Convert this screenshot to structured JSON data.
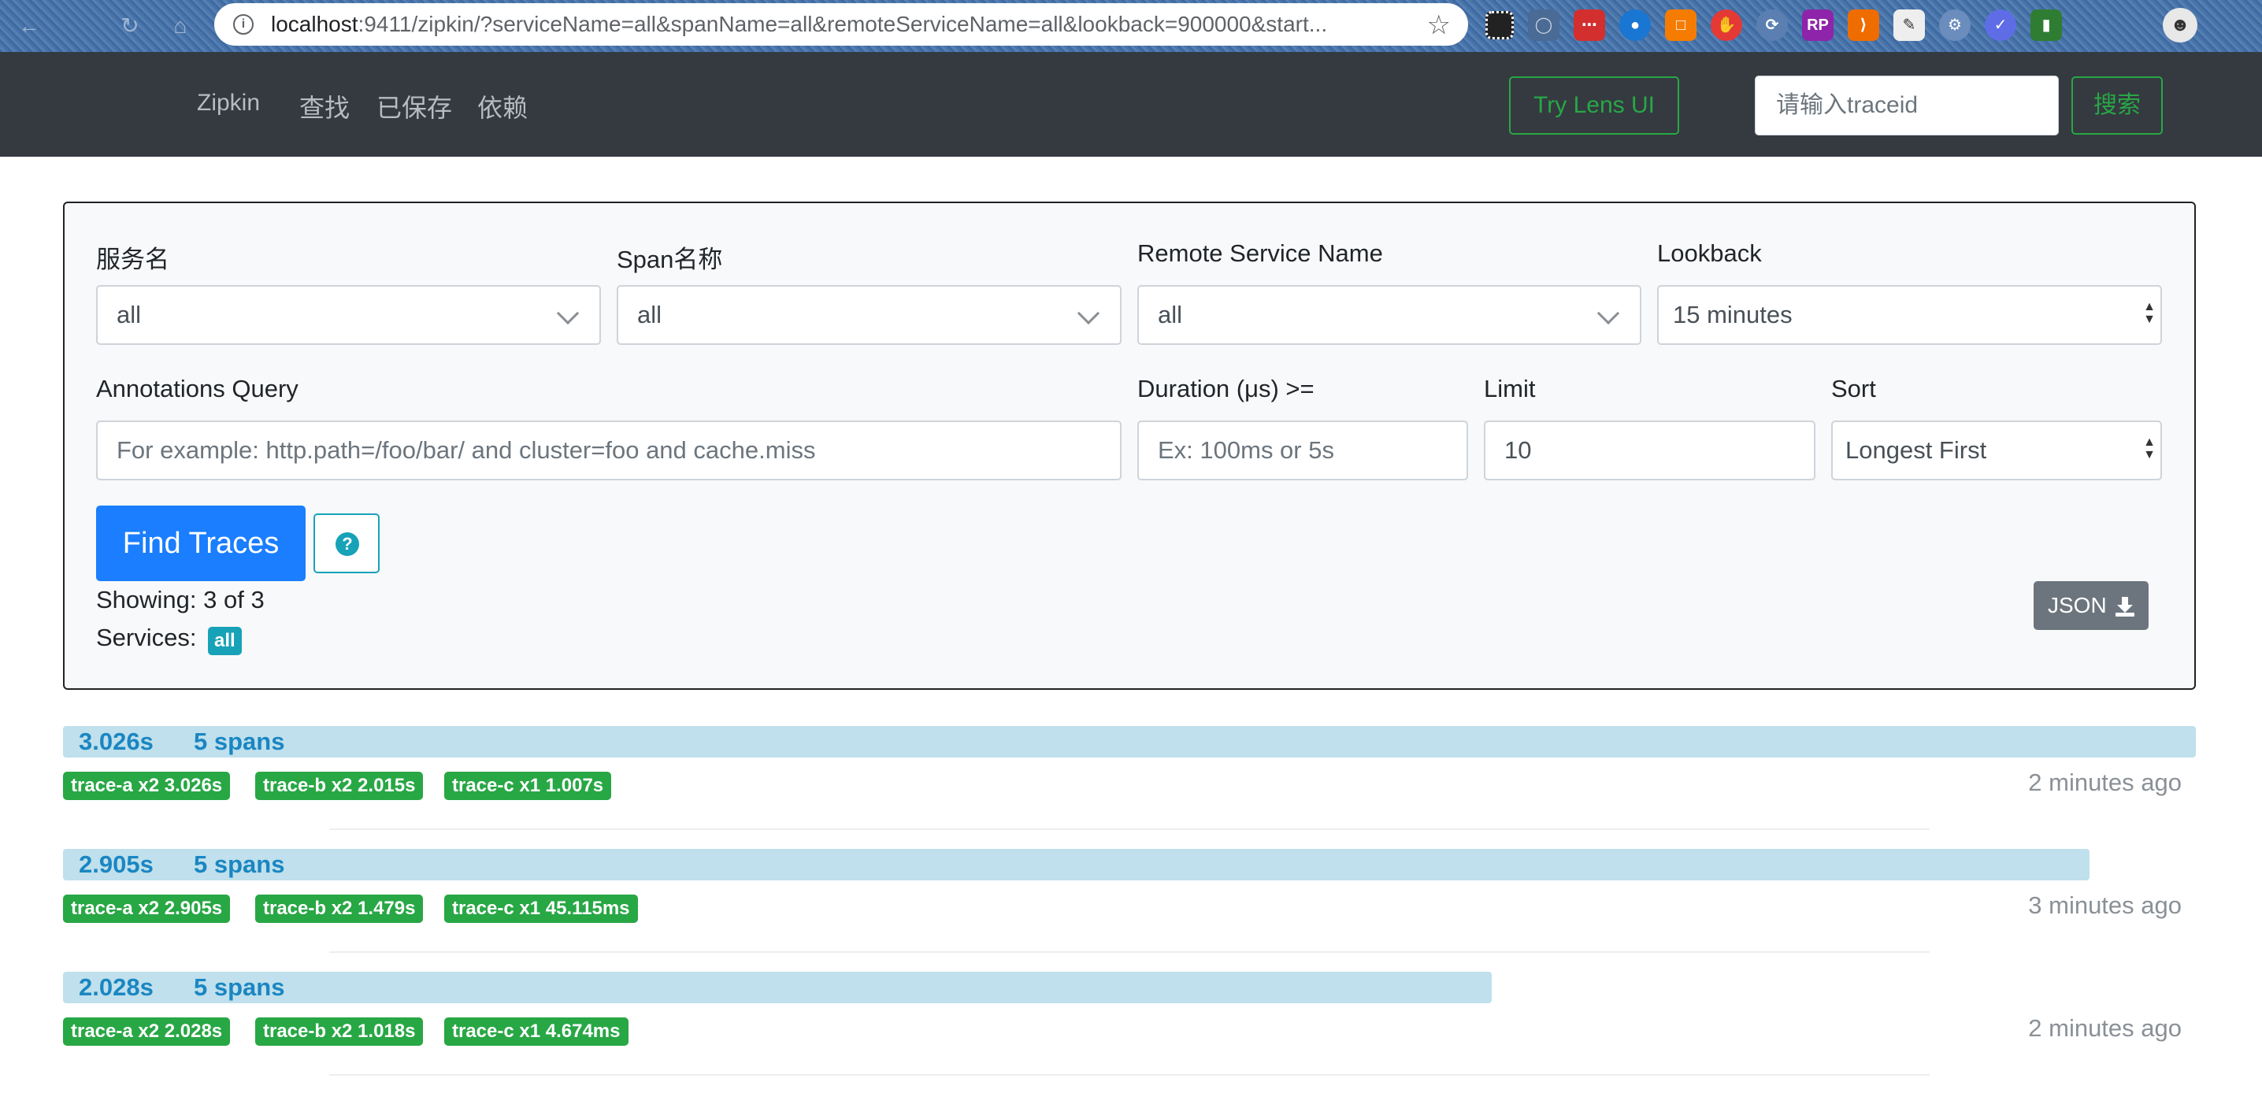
{
  "browser": {
    "url_host": "localhost",
    "url_rest": ":9411/zipkin/?serviceName=all&spanName=all&remoteServiceName=all&lookback=900000&start...",
    "icons": [
      "back-icon",
      "forward-icon",
      "home-icon",
      "info-icon",
      "star-icon"
    ]
  },
  "navbar": {
    "brand": "Zipkin",
    "links": [
      "查找",
      "已保存",
      "依赖"
    ],
    "lens_button": "Try Lens UI",
    "traceid_placeholder": "请输入traceid",
    "search_button": "搜索"
  },
  "search": {
    "service_label": "服务名",
    "service_value": "all",
    "span_label": "Span名称",
    "span_value": "all",
    "remote_label": "Remote Service Name",
    "remote_value": "all",
    "lookback_label": "Lookback",
    "lookback_value": "15 minutes",
    "annotations_label": "Annotations Query",
    "annotations_placeholder": "For example: http.path=/foo/bar/ and cluster=foo and cache.miss",
    "duration_label": "Duration (μs) >=",
    "duration_placeholder": "Ex: 100ms or 5s",
    "limit_label": "Limit",
    "limit_value": "10",
    "sort_label": "Sort",
    "sort_value": "Longest First",
    "find_button": "Find Traces",
    "help_glyph": "?",
    "showing_text": "Showing: 3 of 3",
    "services_label": "Services:",
    "services_badge": "all",
    "json_button": "JSON"
  },
  "traces": [
    {
      "duration": "3.026s",
      "spans": "5 spans",
      "bar_fraction": 1.0,
      "badges": [
        "trace-a x2 3.026s",
        "trace-b x2 2.015s",
        "trace-c x1 1.007s"
      ],
      "time_ago": "2 minutes ago"
    },
    {
      "duration": "2.905s",
      "spans": "5 spans",
      "bar_fraction": 0.95,
      "badges": [
        "trace-a x2 2.905s",
        "trace-b x2 1.479s",
        "trace-c x1 45.115ms"
      ],
      "time_ago": "3 minutes ago"
    },
    {
      "duration": "2.028s",
      "spans": "5 spans",
      "bar_fraction": 0.67,
      "badges": [
        "trace-a x2 2.028s",
        "trace-b x2 1.018s",
        "trace-c x1 4.674ms"
      ],
      "time_ago": "2 minutes ago"
    }
  ],
  "colors": {
    "navbar_bg": "#343a40",
    "primary": "#1a7eff",
    "success": "#28a745",
    "info": "#17a2b8",
    "trace_bar": "#bfe0ec",
    "trace_text": "#1a86c2"
  }
}
